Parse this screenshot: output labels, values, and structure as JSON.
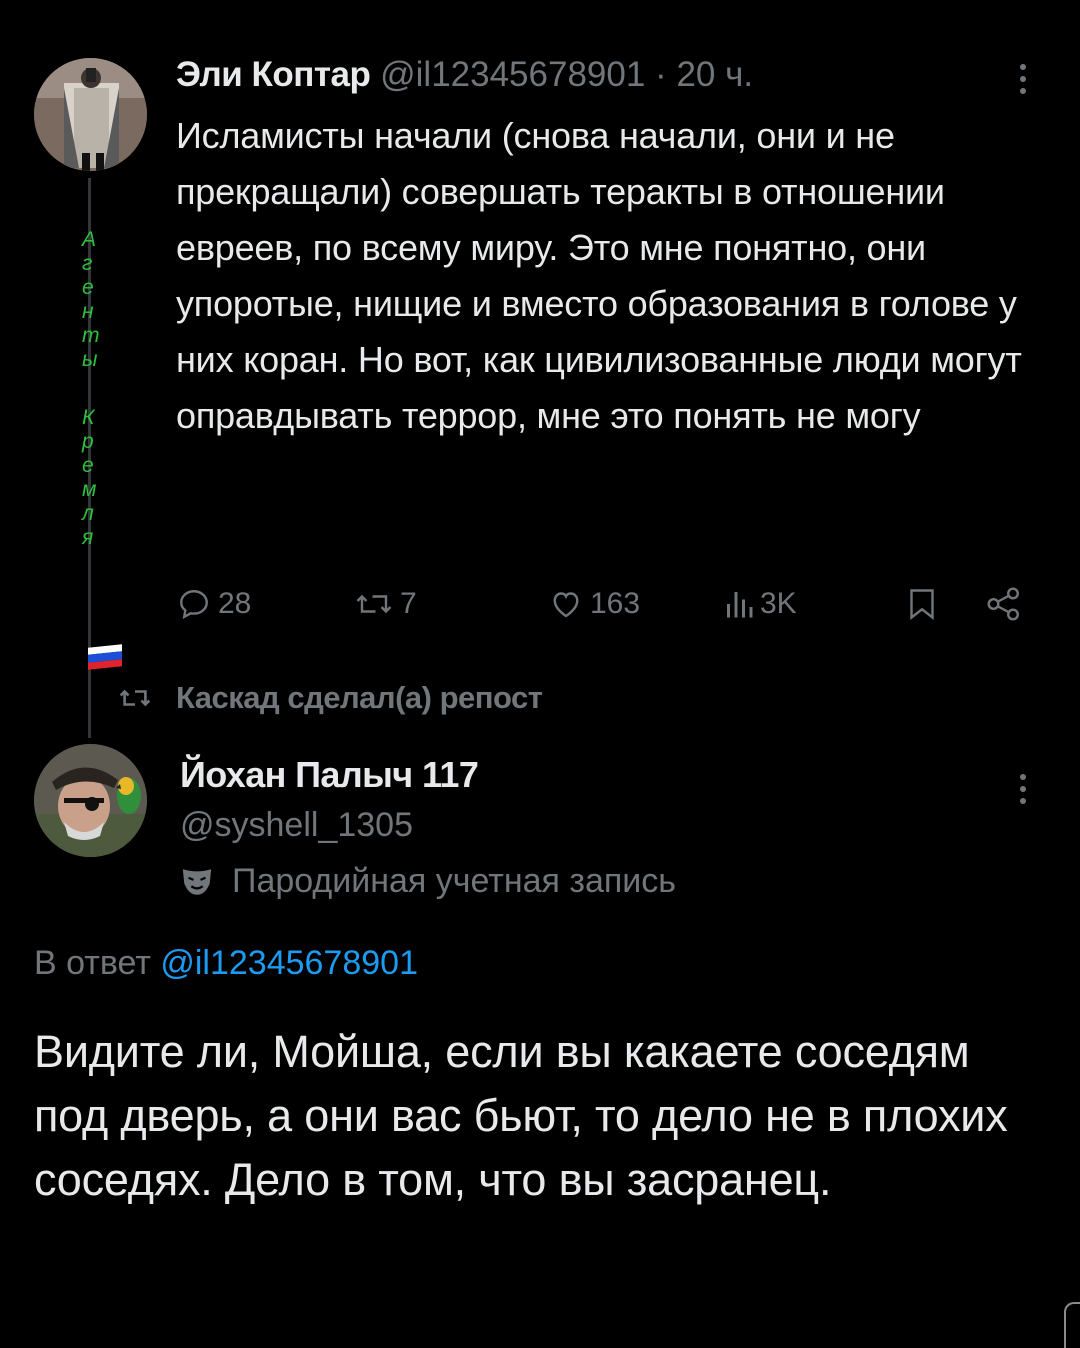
{
  "tweet1": {
    "author_name": "Эли Коптар",
    "author_handle": "@il12345678901",
    "separator": "·",
    "time": "20 ч.",
    "bio_vertical_letters": [
      "А",
      "г",
      "е",
      "н",
      "т",
      "ы",
      "",
      "К",
      "р",
      "е",
      "м",
      "л",
      "я"
    ],
    "text": "Исламисты начали (снова начали, они и не прекращали) совершать теракты в отношении евреев, по всему миру. Это мне понятно, они упоротые, нищие и вместо образования в голове у них коран. Но вот, как цивилизованные люди могут оправдывать террор, мне это понять не могу",
    "actions": {
      "replies": "28",
      "reposts": "7",
      "likes": "163",
      "views": "3K"
    },
    "avatar_icon": "user-photo-avatar",
    "flag_colors": [
      "#ffffff",
      "#1c4fd8",
      "#e0242d"
    ]
  },
  "repost_notice": {
    "text": "Каскад сделал(а) репост",
    "icon": "repost-icon"
  },
  "tweet2": {
    "author_name": "Йохан Палыч 117",
    "author_handle": "@syshell_1305",
    "parody_label": "Пародийная учетная запись",
    "parody_icon": "theater-mask-icon",
    "reply_prefix": "В ответ",
    "reply_handle": "@il12345678901",
    "text": "Видите ли, Мойша, если вы какаете соседям под дверь, а они вас бьют, то дело не в плохих соседях. Дело в том, что вы засранец.",
    "avatar_icon": "pirate-avatar"
  },
  "colors": {
    "background": "#000000",
    "text": "#e7e9ea",
    "muted": "#71767b",
    "link": "#1d9bf0",
    "bio_green": "#2fbf3f"
  }
}
